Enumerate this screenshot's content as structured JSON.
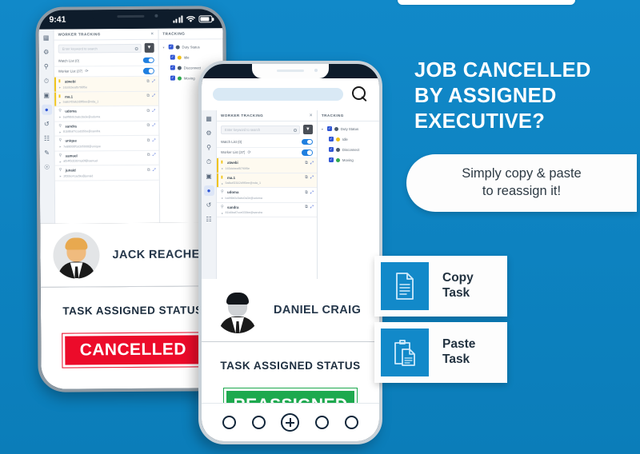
{
  "headline": {
    "line1": "JOB CANCELLED",
    "line2": "BY ASSIGNED",
    "line3": "EXECUTIVE?"
  },
  "subtitle": {
    "line1": "Simply copy & paste",
    "line2": "to reassign it!"
  },
  "action_cards": [
    {
      "icon": "copy-document-icon",
      "label_line1": "Copy",
      "label_line2": "Task"
    },
    {
      "icon": "paste-clipboard-icon",
      "label_line1": "Paste",
      "label_line2": "Task"
    }
  ],
  "colors": {
    "background_blue": "#1189c9",
    "accent_blue": "#1289c9",
    "cancelled_red": "#ec0b2a",
    "reassigned_green": "#1da94e",
    "checkbox_blue": "#2f55d4",
    "toggle_blue": "#1f7fe0"
  },
  "back_phone": {
    "statusbar": {
      "time": "9:41",
      "signal": "signal-bars-icon",
      "wifi": "wifi-icon",
      "battery": "battery-icon"
    },
    "rail_icons": [
      "dashboard-icon",
      "settings-gear-icon",
      "search-icon",
      "clock-icon",
      "report-icon",
      "location-pin-icon",
      "history-icon",
      "team-icon",
      "edit-icon",
      "profile-icon"
    ],
    "left_panel": {
      "header": "WORKER TRACKING",
      "close": "×",
      "search_placeholder": "Enter keyword to search",
      "filter_icon": "filter-funnel-icon",
      "rows": [
        {
          "label": "Watch List (0)",
          "toggle": "on"
        },
        {
          "label": "Worker List (37)",
          "toggle": "on",
          "refresh": "refresh-icon"
        }
      ],
      "workers": [
        {
          "name": "atwebi",
          "id": "163dcbeaf5790f5e",
          "highlight": true
        },
        {
          "name": "ma.1",
          "id": "5a8c#D3&2d9f0ee@nda_1",
          "highlight": true
        },
        {
          "name": "udoma",
          "id": "ba9f8b0c5abc0a3e@udoma",
          "highlight": false
        },
        {
          "name": "sandra",
          "id": "81b8baf7cce035be@sandra",
          "highlight": false
        },
        {
          "name": "unique",
          "id": "7e88000f52cB5bb8@unique",
          "highlight": false
        },
        {
          "name": "samuel",
          "id": "af54f0c0287a30f@samuel",
          "highlight": false
        },
        {
          "name": "junaid",
          "id": "2f0bbc41ad9e@junaid",
          "highlight": false
        }
      ]
    },
    "right_panel": {
      "header": "TRACKING",
      "tree": [
        {
          "label": "Duty Status",
          "color": "#4a5a6b",
          "checked": true,
          "caret": "▾",
          "level": 0
        },
        {
          "label": "Idle",
          "color": "#f2c014",
          "checked": true,
          "level": 1
        },
        {
          "label": "Disconnect",
          "color": "#4a5a6b",
          "checked": true,
          "level": 1
        },
        {
          "label": "Moving",
          "color": "#2fa84f",
          "checked": true,
          "level": 1
        }
      ]
    },
    "profile": {
      "name": "JACK REACHER",
      "avatar": "avatar-light-man"
    },
    "status": {
      "title": "TASK ASSIGNED STATUS",
      "badge": "CANCELLED"
    }
  },
  "front_phone": {
    "search": {
      "value": "",
      "placeholder": "",
      "icon": "search-icon"
    },
    "rail_icons": [
      "dashboard-icon",
      "settings-gear-icon",
      "search-icon",
      "clock-icon",
      "report-icon",
      "location-pin-icon",
      "history-icon",
      "team-icon"
    ],
    "left_panel": {
      "header": "WORKER TRACKING",
      "close": "×",
      "search_placeholder": "Enter keyword to search",
      "filter_icon": "filter-funnel-icon",
      "rows": [
        {
          "label": "Watch List (0)",
          "toggle": "on"
        },
        {
          "label": "Worker List (37)",
          "toggle": "on",
          "refresh": "refresh-icon"
        }
      ],
      "workers": [
        {
          "name": "atwebi",
          "id": "163dcbeaf5790f5e",
          "highlight": true
        },
        {
          "name": "ma.1",
          "id": "5a8c#D3&2d9f0ee@nda_1",
          "highlight": true
        },
        {
          "name": "udoma",
          "id": "ba9f8b0c5abc0a3e@udoma",
          "highlight": false
        },
        {
          "name": "sandra",
          "id": "81b8baf7cce035be@sandra",
          "highlight": false
        }
      ]
    },
    "right_panel": {
      "header": "TRACKING",
      "tree": [
        {
          "label": "Duty Status",
          "color": "#4a5a6b",
          "checked": true,
          "caret": "▾",
          "level": 0
        },
        {
          "label": "Idle",
          "color": "#f2c014",
          "checked": true,
          "level": 1
        },
        {
          "label": "Disconnect",
          "color": "#4a5a6b",
          "checked": true,
          "level": 1
        },
        {
          "label": "Moving",
          "color": "#2fa84f",
          "checked": true,
          "level": 1
        }
      ]
    },
    "profile": {
      "name": "DANIEL CRAIG",
      "avatar": "avatar-dark-man"
    },
    "status": {
      "title": "TASK ASSIGNED STATUS",
      "badge": "REASSIGNED"
    },
    "bottom_nav": [
      {
        "icon": "circle-icon"
      },
      {
        "icon": "circle-icon"
      },
      {
        "icon": "plus-circle-icon"
      },
      {
        "icon": "circle-icon"
      },
      {
        "icon": "circle-icon"
      }
    ]
  }
}
